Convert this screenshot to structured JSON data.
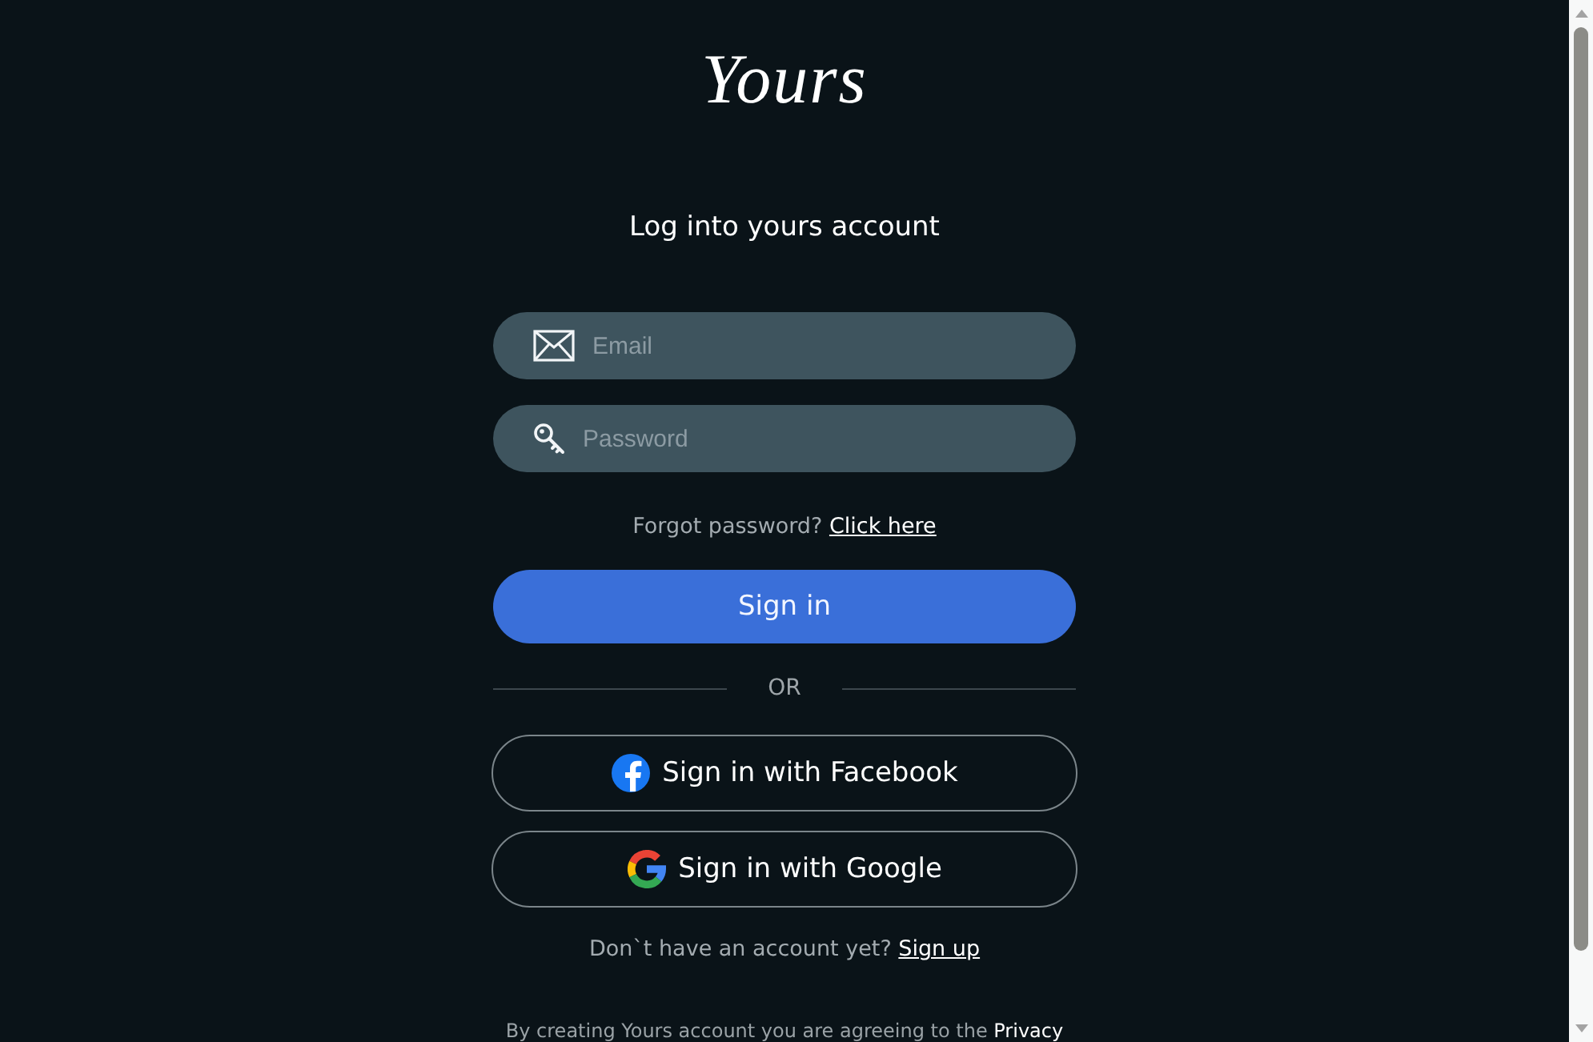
{
  "logo": {
    "text": "Yours"
  },
  "heading": "Log into yours account",
  "fields": [
    {
      "kind": "email",
      "placeholder": "Email"
    },
    {
      "kind": "password",
      "placeholder": "Password"
    }
  ],
  "forgot": {
    "text": "Forgot password?",
    "link": "Click here"
  },
  "sign_in_button": "Sign in",
  "divider": "OR",
  "social_buttons": [
    {
      "kind": "facebook",
      "label": "Sign in with Facebook"
    },
    {
      "kind": "google",
      "label": "Sign in with Google"
    }
  ],
  "signup": {
    "text": "Don`t have an account yet?",
    "link": "Sign up"
  },
  "legal": {
    "text": "By creating Yours account you are agreeing to the",
    "link": "Privacy"
  }
}
